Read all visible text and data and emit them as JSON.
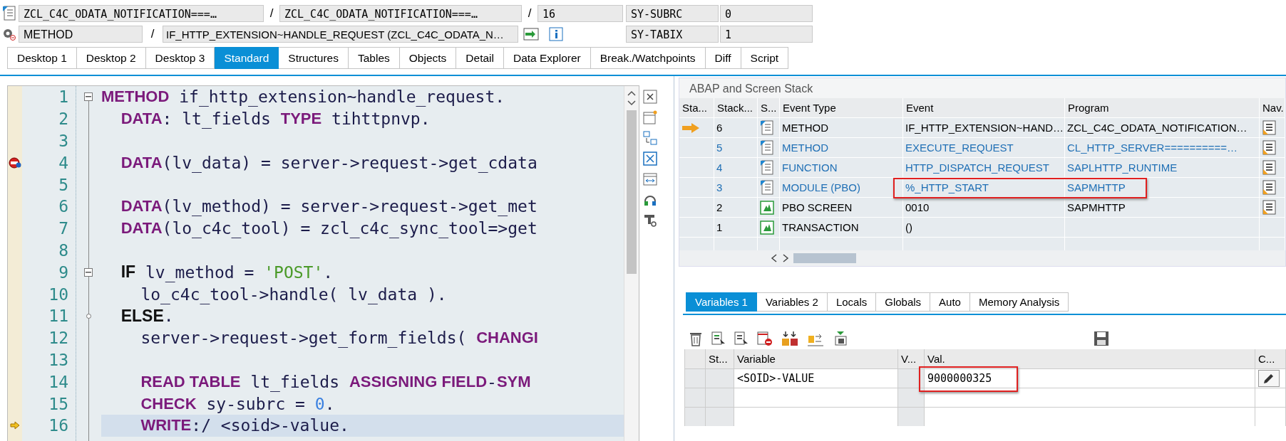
{
  "header": {
    "row1": {
      "include": "ZCL_C4C_ODATA_NOTIFICATION===…",
      "sep1": "/",
      "program": "ZCL_C4C_ODATA_NOTIFICATION===…",
      "sep2": "/",
      "line": "16",
      "field_name": "SY-SUBRC",
      "field_value": "0"
    },
    "row2": {
      "event_type": "METHOD",
      "sep": "/",
      "event": "IF_HTTP_EXTENSION~HANDLE_REQUEST (ZCL_C4C_ODATA_N…",
      "field_name": "SY-TABIX",
      "field_value": "1"
    }
  },
  "tabs": [
    {
      "label": "Desktop 1",
      "selected": false
    },
    {
      "label": "Desktop 2",
      "selected": false
    },
    {
      "label": "Desktop 3",
      "selected": false
    },
    {
      "label": "Standard",
      "selected": true
    },
    {
      "label": "Structures",
      "selected": false
    },
    {
      "label": "Tables",
      "selected": false
    },
    {
      "label": "Objects",
      "selected": false
    },
    {
      "label": "Detail",
      "selected": false
    },
    {
      "label": "Data Explorer",
      "selected": false
    },
    {
      "label": "Break./Watchpoints",
      "selected": false
    },
    {
      "label": "Diff",
      "selected": false
    },
    {
      "label": "Script",
      "selected": false
    }
  ],
  "code": {
    "lines": [
      {
        "number": "1",
        "collapsible": true,
        "tokens": [
          {
            "kind": "keyword",
            "text": "METHOD"
          },
          {
            "kind": "plain",
            "text": " if_http_extension~handle_request."
          }
        ]
      },
      {
        "number": "2",
        "tokens": [
          {
            "kind": "keyword",
            "text": "  DATA"
          },
          {
            "kind": "plain",
            "text": ": lt_fields "
          },
          {
            "kind": "keyword",
            "text": "TYPE"
          },
          {
            "kind": "plain",
            "text": " tihttpnvp."
          }
        ]
      },
      {
        "number": "3"
      },
      {
        "number": "4",
        "breakpoint": true,
        "tokens": [
          {
            "kind": "keyword",
            "text": "  DATA"
          },
          {
            "kind": "plain",
            "text": "(lv_data) = server->request->get_cdata"
          }
        ]
      },
      {
        "number": "5"
      },
      {
        "number": "6",
        "tokens": [
          {
            "kind": "keyword",
            "text": "  DATA"
          },
          {
            "kind": "plain",
            "text": "(lv_method) = server->request->get_met"
          }
        ]
      },
      {
        "number": "7",
        "tokens": [
          {
            "kind": "keyword",
            "text": "  DATA"
          },
          {
            "kind": "plain",
            "text": "(lo_c4c_tool) = zcl_c4c_sync_tool=>get"
          }
        ]
      },
      {
        "number": "8"
      },
      {
        "number": "9",
        "collapsible": true,
        "tokens": [
          {
            "kind": "control",
            "text": "  IF"
          },
          {
            "kind": "plain",
            "text": " lv_method = "
          },
          {
            "kind": "string",
            "text": "'POST'"
          },
          {
            "kind": "plain",
            "text": "."
          }
        ]
      },
      {
        "number": "10",
        "tokens": [
          {
            "kind": "plain",
            "text": "    lo_c4c_tool->handle( lv_data )."
          }
        ]
      },
      {
        "number": "11",
        "branch": true,
        "tokens": [
          {
            "kind": "control",
            "text": "  ELSE"
          },
          {
            "kind": "plain",
            "text": "."
          }
        ]
      },
      {
        "number": "12",
        "tokens": [
          {
            "kind": "plain",
            "text": "    server->request->get_form_fields( "
          },
          {
            "kind": "keyword",
            "text": "CHANGI"
          }
        ]
      },
      {
        "number": "13"
      },
      {
        "number": "14",
        "tokens": [
          {
            "kind": "keyword",
            "text": "    READ TABLE"
          },
          {
            "kind": "plain",
            "text": " lt_fields "
          },
          {
            "kind": "keyword",
            "text": "ASSIGNING FIELD"
          },
          {
            "kind": "plain",
            "text": "-"
          },
          {
            "kind": "keyword",
            "text": "SYM"
          }
        ]
      },
      {
        "number": "15",
        "tokens": [
          {
            "kind": "keyword",
            "text": "    CHECK"
          },
          {
            "kind": "plain",
            "text": " sy-subrc = "
          },
          {
            "kind": "number",
            "text": "0"
          },
          {
            "kind": "plain",
            "text": "."
          }
        ]
      },
      {
        "number": "16",
        "current": true,
        "tokens": [
          {
            "kind": "keyword",
            "text": "    WRITE"
          },
          {
            "kind": "plain",
            "text": ":/ <soid>-value."
          }
        ]
      }
    ]
  },
  "stack": {
    "title": "ABAP and Screen Stack",
    "columns": [
      "Sta...",
      "Stack...",
      "S...",
      "Event Type",
      "Event",
      "Program",
      "Nav."
    ],
    "rows": [
      {
        "current": true,
        "stack_no": "6",
        "kind": "abap",
        "event_type": "METHOD",
        "event": "IF_HTTP_EXTENSION~HAND…",
        "program": "ZCL_C4C_ODATA_NOTIFICATION…",
        "color": "#000000",
        "nav": true
      },
      {
        "stack_no": "5",
        "kind": "abap",
        "event_type": "METHOD",
        "event": "EXECUTE_REQUEST",
        "program": "CL_HTTP_SERVER==========…",
        "color": "#1f6fb5",
        "nav": true
      },
      {
        "stack_no": "4",
        "kind": "abap",
        "event_type": "FUNCTION",
        "event": "HTTP_DISPATCH_REQUEST",
        "program": "SAPLHTTP_RUNTIME",
        "color": "#1f6fb5",
        "nav": true
      },
      {
        "stack_no": "3",
        "kind": "abap",
        "event_type": "MODULE (PBO)",
        "event": "%_HTTP_START",
        "program": "SAPMHTTP",
        "color": "#1f6fb5",
        "nav": true,
        "boxed": true
      },
      {
        "stack_no": "2",
        "kind": "screen",
        "event_type": "PBO SCREEN",
        "event": "0010",
        "program": "SAPMHTTP",
        "color": "#000000",
        "nav": true
      },
      {
        "stack_no": "1",
        "kind": "screen",
        "event_type": "TRANSACTION",
        "event": "()",
        "color": "#000000"
      }
    ]
  },
  "variable_tabs": [
    {
      "label": "Variables 1",
      "selected": true
    },
    {
      "label": "Variables 2",
      "selected": false
    },
    {
      "label": "Locals",
      "selected": false
    },
    {
      "label": "Globals",
      "selected": false
    },
    {
      "label": "Auto",
      "selected": false
    },
    {
      "label": "Memory Analysis",
      "selected": false
    }
  ],
  "variables": {
    "columns": [
      "St...",
      "Variable",
      "V...",
      "Val.",
      "C..."
    ],
    "rows": [
      {
        "variable": "<SOID>-VALUE",
        "value": "9000000325",
        "boxed": true,
        "editable": true
      }
    ]
  }
}
